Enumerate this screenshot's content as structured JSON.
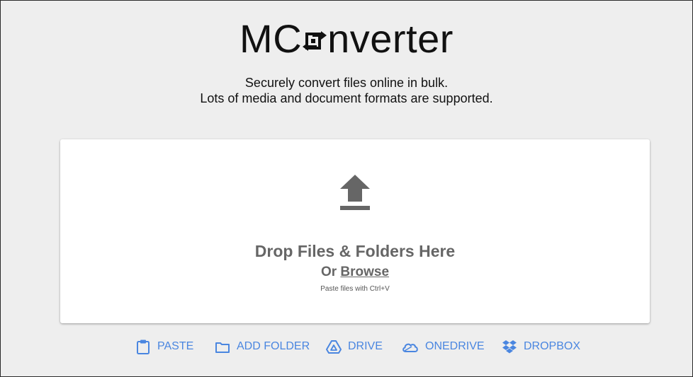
{
  "logo": {
    "prefix": "MC",
    "suffix": "nverter"
  },
  "tagline": {
    "line1": "Securely convert files online in bulk.",
    "line2": "Lots of media and document formats are supported."
  },
  "dropzone": {
    "title": "Drop Files & Folders Here",
    "or_label": "Or",
    "browse_label": "Browse",
    "paste_hint": "Paste files with Ctrl+V"
  },
  "actions": [
    {
      "label": "PASTE",
      "icon": "clipboard-icon"
    },
    {
      "label": "ADD FOLDER",
      "icon": "folder-icon"
    },
    {
      "label": "DRIVE",
      "icon": "google-drive-icon"
    },
    {
      "label": "ONEDRIVE",
      "icon": "onedrive-icon"
    },
    {
      "label": "DROPBOX",
      "icon": "dropbox-icon"
    }
  ],
  "colors": {
    "background": "#eeeeee",
    "accent": "#4a86e0",
    "dropzone_text": "#666666"
  }
}
